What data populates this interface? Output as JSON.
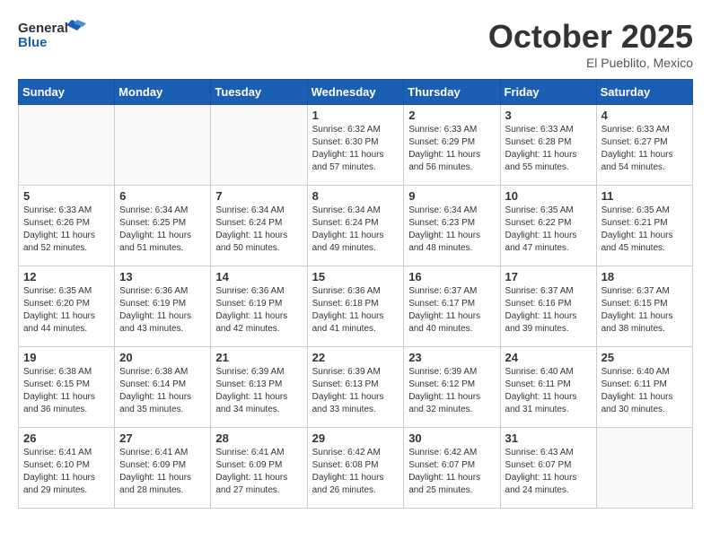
{
  "header": {
    "logo_general": "General",
    "logo_blue": "Blue",
    "month": "October 2025",
    "location": "El Pueblito, Mexico"
  },
  "days_of_week": [
    "Sunday",
    "Monday",
    "Tuesday",
    "Wednesday",
    "Thursday",
    "Friday",
    "Saturday"
  ],
  "weeks": [
    [
      {
        "day": "",
        "info": ""
      },
      {
        "day": "",
        "info": ""
      },
      {
        "day": "",
        "info": ""
      },
      {
        "day": "1",
        "info": "Sunrise: 6:32 AM\nSunset: 6:30 PM\nDaylight: 11 hours and 57 minutes."
      },
      {
        "day": "2",
        "info": "Sunrise: 6:33 AM\nSunset: 6:29 PM\nDaylight: 11 hours and 56 minutes."
      },
      {
        "day": "3",
        "info": "Sunrise: 6:33 AM\nSunset: 6:28 PM\nDaylight: 11 hours and 55 minutes."
      },
      {
        "day": "4",
        "info": "Sunrise: 6:33 AM\nSunset: 6:27 PM\nDaylight: 11 hours and 54 minutes."
      }
    ],
    [
      {
        "day": "5",
        "info": "Sunrise: 6:33 AM\nSunset: 6:26 PM\nDaylight: 11 hours and 52 minutes."
      },
      {
        "day": "6",
        "info": "Sunrise: 6:34 AM\nSunset: 6:25 PM\nDaylight: 11 hours and 51 minutes."
      },
      {
        "day": "7",
        "info": "Sunrise: 6:34 AM\nSunset: 6:24 PM\nDaylight: 11 hours and 50 minutes."
      },
      {
        "day": "8",
        "info": "Sunrise: 6:34 AM\nSunset: 6:24 PM\nDaylight: 11 hours and 49 minutes."
      },
      {
        "day": "9",
        "info": "Sunrise: 6:34 AM\nSunset: 6:23 PM\nDaylight: 11 hours and 48 minutes."
      },
      {
        "day": "10",
        "info": "Sunrise: 6:35 AM\nSunset: 6:22 PM\nDaylight: 11 hours and 47 minutes."
      },
      {
        "day": "11",
        "info": "Sunrise: 6:35 AM\nSunset: 6:21 PM\nDaylight: 11 hours and 45 minutes."
      }
    ],
    [
      {
        "day": "12",
        "info": "Sunrise: 6:35 AM\nSunset: 6:20 PM\nDaylight: 11 hours and 44 minutes."
      },
      {
        "day": "13",
        "info": "Sunrise: 6:36 AM\nSunset: 6:19 PM\nDaylight: 11 hours and 43 minutes."
      },
      {
        "day": "14",
        "info": "Sunrise: 6:36 AM\nSunset: 6:19 PM\nDaylight: 11 hours and 42 minutes."
      },
      {
        "day": "15",
        "info": "Sunrise: 6:36 AM\nSunset: 6:18 PM\nDaylight: 11 hours and 41 minutes."
      },
      {
        "day": "16",
        "info": "Sunrise: 6:37 AM\nSunset: 6:17 PM\nDaylight: 11 hours and 40 minutes."
      },
      {
        "day": "17",
        "info": "Sunrise: 6:37 AM\nSunset: 6:16 PM\nDaylight: 11 hours and 39 minutes."
      },
      {
        "day": "18",
        "info": "Sunrise: 6:37 AM\nSunset: 6:15 PM\nDaylight: 11 hours and 38 minutes."
      }
    ],
    [
      {
        "day": "19",
        "info": "Sunrise: 6:38 AM\nSunset: 6:15 PM\nDaylight: 11 hours and 36 minutes."
      },
      {
        "day": "20",
        "info": "Sunrise: 6:38 AM\nSunset: 6:14 PM\nDaylight: 11 hours and 35 minutes."
      },
      {
        "day": "21",
        "info": "Sunrise: 6:39 AM\nSunset: 6:13 PM\nDaylight: 11 hours and 34 minutes."
      },
      {
        "day": "22",
        "info": "Sunrise: 6:39 AM\nSunset: 6:13 PM\nDaylight: 11 hours and 33 minutes."
      },
      {
        "day": "23",
        "info": "Sunrise: 6:39 AM\nSunset: 6:12 PM\nDaylight: 11 hours and 32 minutes."
      },
      {
        "day": "24",
        "info": "Sunrise: 6:40 AM\nSunset: 6:11 PM\nDaylight: 11 hours and 31 minutes."
      },
      {
        "day": "25",
        "info": "Sunrise: 6:40 AM\nSunset: 6:11 PM\nDaylight: 11 hours and 30 minutes."
      }
    ],
    [
      {
        "day": "26",
        "info": "Sunrise: 6:41 AM\nSunset: 6:10 PM\nDaylight: 11 hours and 29 minutes."
      },
      {
        "day": "27",
        "info": "Sunrise: 6:41 AM\nSunset: 6:09 PM\nDaylight: 11 hours and 28 minutes."
      },
      {
        "day": "28",
        "info": "Sunrise: 6:41 AM\nSunset: 6:09 PM\nDaylight: 11 hours and 27 minutes."
      },
      {
        "day": "29",
        "info": "Sunrise: 6:42 AM\nSunset: 6:08 PM\nDaylight: 11 hours and 26 minutes."
      },
      {
        "day": "30",
        "info": "Sunrise: 6:42 AM\nSunset: 6:07 PM\nDaylight: 11 hours and 25 minutes."
      },
      {
        "day": "31",
        "info": "Sunrise: 6:43 AM\nSunset: 6:07 PM\nDaylight: 11 hours and 24 minutes."
      },
      {
        "day": "",
        "info": ""
      }
    ]
  ]
}
